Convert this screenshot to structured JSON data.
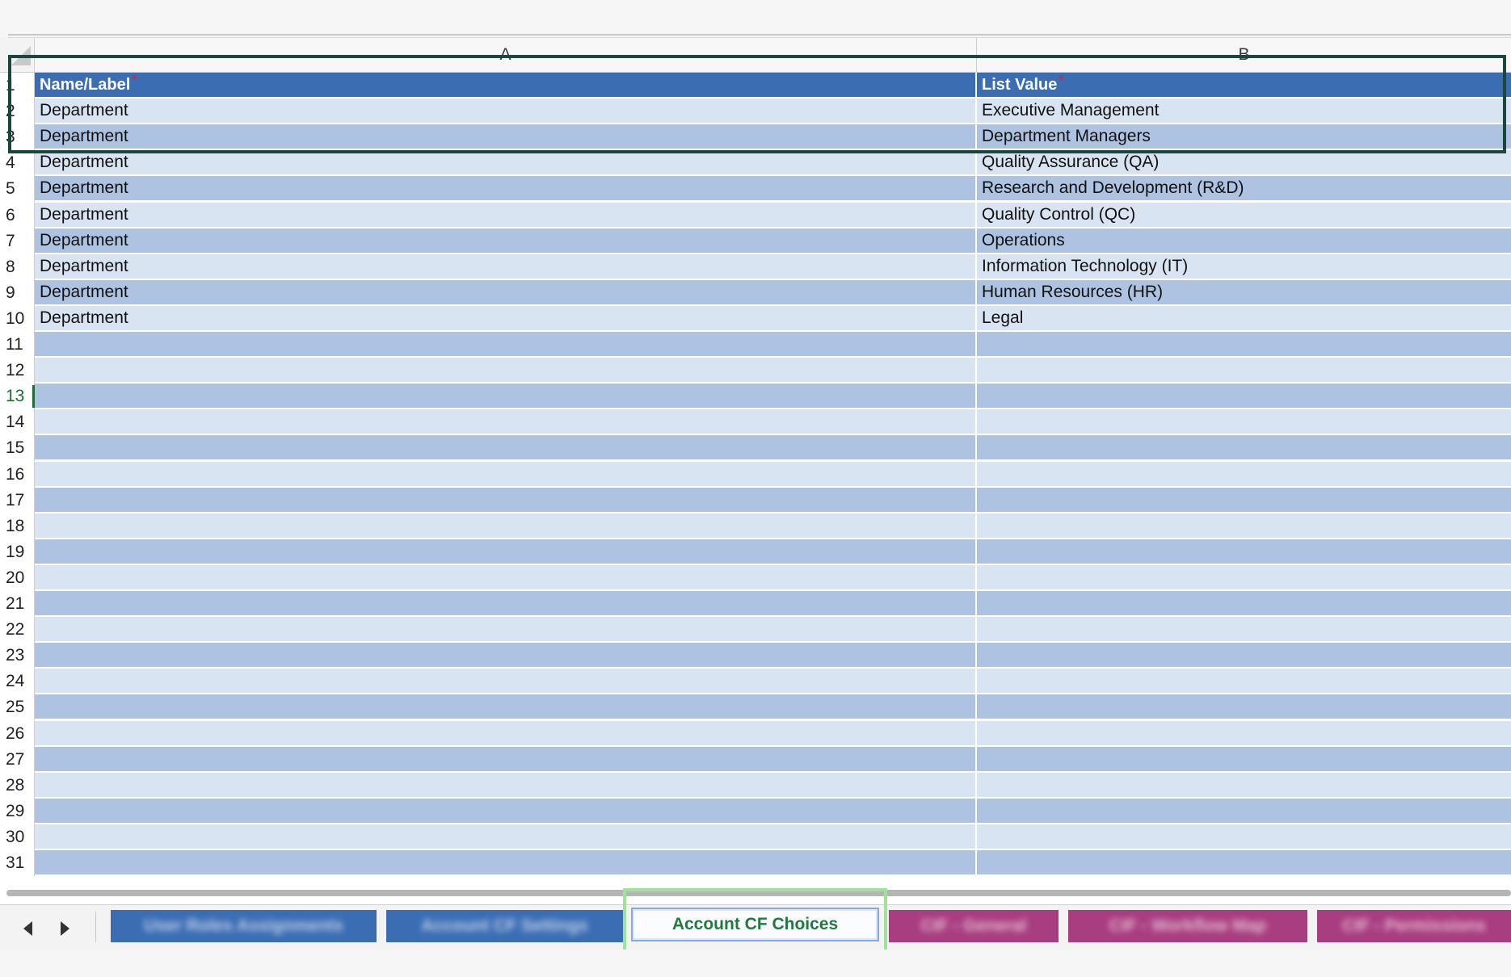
{
  "columns": [
    "A",
    "B"
  ],
  "header": {
    "name_label": "Name/Label",
    "list_value": "List Value",
    "required_mark": "*"
  },
  "row_numbers": [
    "1",
    "2",
    "3",
    "4",
    "5",
    "6",
    "7",
    "8",
    "9",
    "10",
    "11",
    "12",
    "13",
    "14",
    "15",
    "16",
    "17",
    "18",
    "19",
    "20",
    "21",
    "22",
    "23",
    "24",
    "25",
    "26",
    "27",
    "28",
    "29",
    "30",
    "31"
  ],
  "active_row": "13",
  "rows": [
    {
      "a": "Department",
      "b": "Executive Management"
    },
    {
      "a": "Department",
      "b": "Department Managers"
    },
    {
      "a": "Department",
      "b": "Quality Assurance (QA)"
    },
    {
      "a": "Department",
      "b": "Research and Development (R&D)"
    },
    {
      "a": "Department",
      "b": "Quality Control (QC)"
    },
    {
      "a": "Department",
      "b": "Operations"
    },
    {
      "a": "Department",
      "b": "Information Technology (IT)"
    },
    {
      "a": "Department",
      "b": "Human Resources (HR)"
    },
    {
      "a": "Department",
      "b": "Legal"
    }
  ],
  "tabs": [
    {
      "label": "User Roles Assignments",
      "color": "blue",
      "blurred": true
    },
    {
      "label": "Account CF Settings",
      "color": "blue",
      "blurred": true
    },
    {
      "label": "Account CF Choices",
      "color": "active",
      "blurred": false
    },
    {
      "label": "CIF - General",
      "color": "magenta",
      "blurred": true
    },
    {
      "label": "CIF - Workflow Map",
      "color": "magenta",
      "blurred": true
    },
    {
      "label": "CIF - Permissions",
      "color": "magenta",
      "blurred": true
    }
  ],
  "colors": {
    "header_blue": "#3b6db3",
    "row_light": "#d9e4f2",
    "row_dark": "#adc3e1",
    "active_tab_text": "#1f7a3c",
    "magenta_tab": "#a83d80",
    "required": "#e0213a"
  }
}
